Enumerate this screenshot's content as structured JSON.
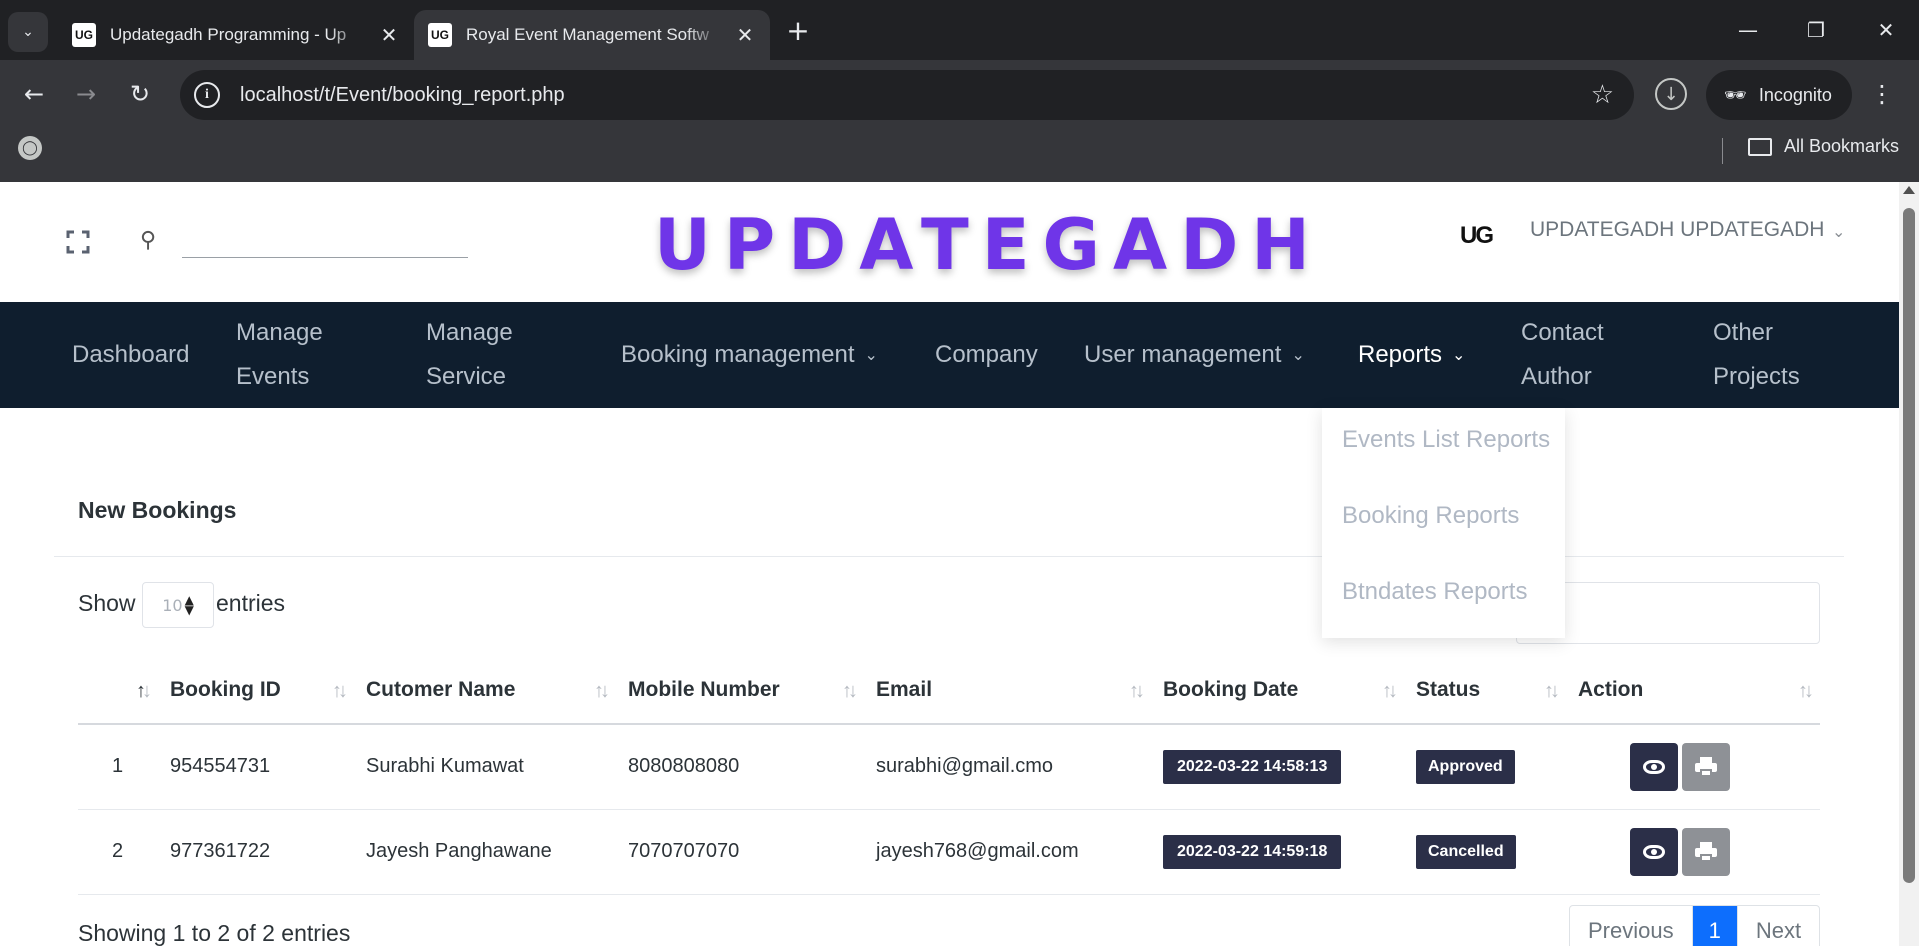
{
  "browser": {
    "tabs": [
      {
        "title": "Updategadh Programming - Up",
        "favicon": "UG",
        "active": false
      },
      {
        "title": "Royal Event Management Softw",
        "favicon": "UG",
        "active": true
      }
    ],
    "url": "localhost/t/Event/booking_report.php",
    "profile_label": "Incognito",
    "bookmarks_label": "All Bookmarks"
  },
  "header": {
    "search_placeholder": "",
    "logo": "UPDATEGADH",
    "user_name": "UPDATEGADH UPDATEGADH",
    "avatar_text": "UG"
  },
  "nav": {
    "dashboard": "Dashboard",
    "manage_events": [
      "Manage",
      "Events"
    ],
    "manage_service": [
      "Manage",
      "Service"
    ],
    "booking_management": "Booking management",
    "company": "Company",
    "user_management": "User management",
    "reports": "Reports",
    "contact_author": [
      "Contact",
      "Author"
    ],
    "other_projects": [
      "Other",
      "Projects"
    ]
  },
  "reports_dropdown": [
    "Events List Reports",
    "Booking Reports",
    "Btndates Reports"
  ],
  "card": {
    "title": "New Bookings",
    "show_label": "Show",
    "entries_label": "entries",
    "page_length": "10"
  },
  "table": {
    "columns": [
      "",
      "Booking ID",
      "Cutomer Name",
      "Mobile Number",
      "Email",
      "Booking Date",
      "Status",
      "Action"
    ],
    "rows": [
      {
        "no": "1",
        "booking_id": "954554731",
        "customer": "Surabhi Kumawat",
        "mobile": "8080808080",
        "email": "surabhi@gmail.cmo",
        "date": "2022-03-22 14:58:13",
        "status": "Approved"
      },
      {
        "no": "2",
        "booking_id": "977361722",
        "customer": "Jayesh Panghawane",
        "mobile": "7070707070",
        "email": "jayesh768@gmail.com",
        "date": "2022-03-22 14:59:18",
        "status": "Cancelled"
      }
    ]
  },
  "footer": {
    "info": "Showing 1 to 2 of 2 entries",
    "previous": "Previous",
    "current_page": "1",
    "next": "Next"
  },
  "colors": {
    "logo": "#6f35e8",
    "navbar": "#0f1e2e",
    "badge": "#2b2f48",
    "pager_active": "#0d6efd"
  }
}
